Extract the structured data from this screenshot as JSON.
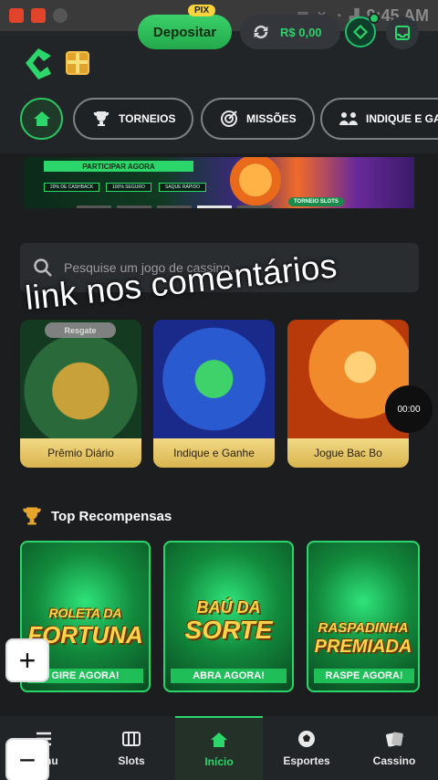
{
  "status_bar": {
    "time": "9:45 AM"
  },
  "header": {
    "deposit_label": "Depositar",
    "pix_badge": "PIX",
    "balance": "R$ 0,00"
  },
  "categories": [
    {
      "label": "TORNEIOS"
    },
    {
      "label": "MISSÕES"
    },
    {
      "label": "INDIQUE E GA"
    }
  ],
  "banner": {
    "cta": "PARTICIPAR AGORA",
    "chips": [
      "20% DE CASHBACK",
      "100% SEGURO",
      "SAQUE RÁPIDO"
    ],
    "tag": "TORNEIO SLOTS"
  },
  "search": {
    "placeholder": "Pesquise um jogo de cassino..."
  },
  "promos": [
    {
      "label": "Prêmio Diário",
      "badge": "Resgate"
    },
    {
      "label": "Indique e Ganhe"
    },
    {
      "label": "Jogue Bac Bo"
    }
  ],
  "overlay_text": "link nos comentários",
  "video_timer": "00:00",
  "top_rewards": {
    "title": "Top Recompensas",
    "items": [
      {
        "line1": "ROLETA DA",
        "line2": "FORTUNA",
        "cta": "GIRE AGORA!"
      },
      {
        "line1": "BAÚ DA",
        "line2": "SORTE",
        "cta": "ABRA AGORA!"
      },
      {
        "line1": "RASPADINHA",
        "line2": "PREMIADA",
        "cta": "RASPE AGORA!"
      }
    ]
  },
  "zoom": {
    "plus": "+",
    "minus": "−"
  },
  "bottom_nav": [
    {
      "label": "Menu",
      "active": false
    },
    {
      "label": "Slots",
      "active": false
    },
    {
      "label": "Início",
      "active": true
    },
    {
      "label": "Esportes",
      "active": false
    },
    {
      "label": "Cassino",
      "active": false
    }
  ],
  "colors": {
    "accent": "#2bd66a",
    "gold": "#e6c25a",
    "background": "#1b1d1f"
  }
}
